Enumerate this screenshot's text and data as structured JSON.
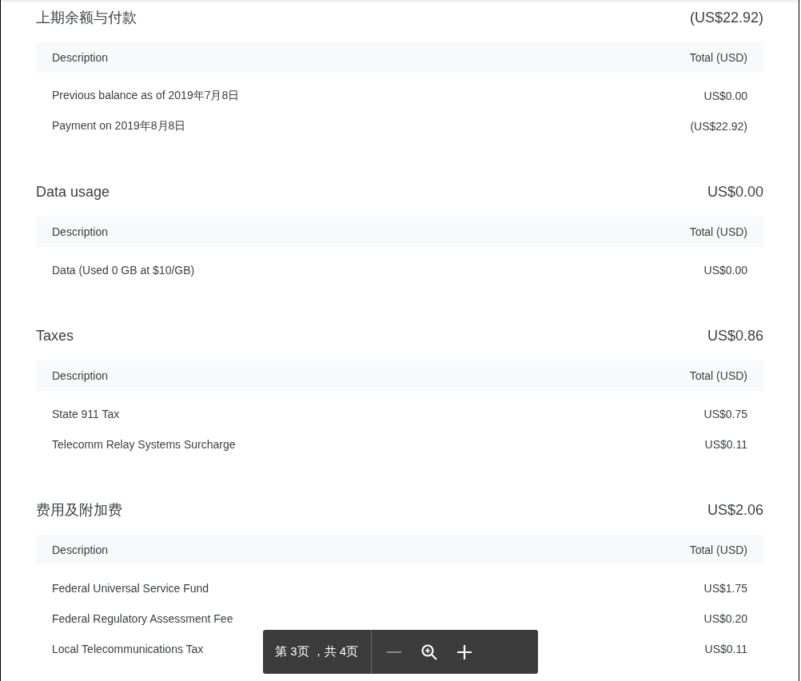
{
  "sections": [
    {
      "title": "上期余额与付款",
      "total": "(US$22.92)",
      "columns": [
        "Description",
        "Total (USD)"
      ],
      "rows": [
        {
          "description": "Previous balance as of 2019年7月8日",
          "amount": "US$0.00"
        },
        {
          "description": "Payment on 2019年8月8日",
          "amount": "(US$22.92)"
        }
      ]
    },
    {
      "title": "Data usage",
      "total": "US$0.00",
      "columns": [
        "Description",
        "Total (USD)"
      ],
      "rows": [
        {
          "description": "Data (Used 0 GB at $10/GB)",
          "amount": "US$0.00"
        }
      ]
    },
    {
      "title": "Taxes",
      "total": "US$0.86",
      "columns": [
        "Description",
        "Total (USD)"
      ],
      "rows": [
        {
          "description": "State 911 Tax",
          "amount": "US$0.75"
        },
        {
          "description": "Telecomm Relay Systems Surcharge",
          "amount": "US$0.11"
        }
      ]
    },
    {
      "title": "费用及附加费",
      "total": "US$2.06",
      "columns": [
        "Description",
        "Total (USD)"
      ],
      "rows": [
        {
          "description": "Federal Universal Service Fund",
          "amount": "US$1.75"
        },
        {
          "description": "Federal Regulatory Assessment Fee",
          "amount": "US$0.20"
        },
        {
          "description": "Local Telecommunications Tax",
          "amount": "US$0.11"
        }
      ]
    }
  ],
  "page_toolbar": {
    "page_label": "第 3页 ，共 4页"
  }
}
